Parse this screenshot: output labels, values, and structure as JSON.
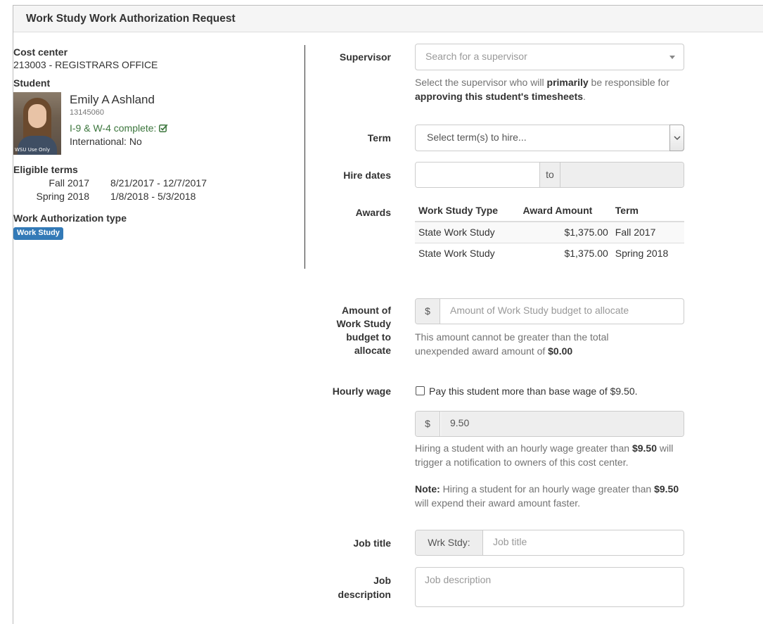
{
  "panel": {
    "title": "Work Study Work Authorization Request"
  },
  "left": {
    "cost_center_label": "Cost center",
    "cost_center_value": "213003 - REGISTRARS OFFICE",
    "student_label": "Student",
    "student": {
      "name": "Emily A Ashland",
      "id": "13145060",
      "photo_stamp": "WSU Use Only",
      "i9_text": "I-9 & W-4 complete:",
      "international": "International: No"
    },
    "eligible_terms_label": "Eligible terms",
    "eligible_terms": [
      {
        "term": "Fall 2017",
        "dates": "8/21/2017 - 12/7/2017"
      },
      {
        "term": "Spring 2018",
        "dates": "1/8/2018 - 5/3/2018"
      }
    ],
    "auth_type_label": "Work Authorization type",
    "auth_type_badge": "Work Study"
  },
  "form": {
    "supervisor": {
      "label": "Supervisor",
      "placeholder": "Search for a supervisor",
      "help_1": "Select the supervisor who will ",
      "help_bold_1": "primarily",
      "help_2": " be responsible for ",
      "help_bold_2": "approving this student's timesheets",
      "help_3": "."
    },
    "term": {
      "label": "Term",
      "placeholder": "Select term(s) to hire..."
    },
    "hire_dates": {
      "label": "Hire dates",
      "separator": "to"
    },
    "awards": {
      "label": "Awards",
      "headers": [
        "Work Study Type",
        "Award Amount",
        "Term"
      ],
      "rows": [
        {
          "type": "State Work Study",
          "amount": "$1,375.00",
          "term": "Fall 2017"
        },
        {
          "type": "State Work Study",
          "amount": "$1,375.00",
          "term": "Spring 2018"
        }
      ]
    },
    "budget": {
      "label_lines": [
        "Amount of",
        "Work Study",
        "budget to",
        "allocate"
      ],
      "addon": "$",
      "placeholder": "Amount of Work Study budget to allocate",
      "help_1": "This amount cannot be greater than the total unexpended award amount of ",
      "help_bold": "$0.00"
    },
    "hourly_wage": {
      "label": "Hourly wage",
      "checkbox_label": "Pay this student more than base wage of $9.50.",
      "addon": "$",
      "value": "9.50",
      "help_1": "Hiring a student with an hourly wage greater than ",
      "help_bold": "$9.50",
      "help_2": " will trigger a notification to owners of this cost center.",
      "note_bold": "Note:",
      "note_1": " Hiring a student for an hourly wage greater than ",
      "note_bold_2": "$9.50",
      "note_2": " will expend their award amount faster."
    },
    "job_title": {
      "label": "Job title",
      "addon": "Wrk Stdy:",
      "placeholder": "Job title"
    },
    "job_description": {
      "label_lines": [
        "Job",
        "description"
      ],
      "placeholder": "Job description"
    }
  },
  "colors": {
    "badge": "#337ab7",
    "success": "#3c763d",
    "muted": "#737373"
  }
}
